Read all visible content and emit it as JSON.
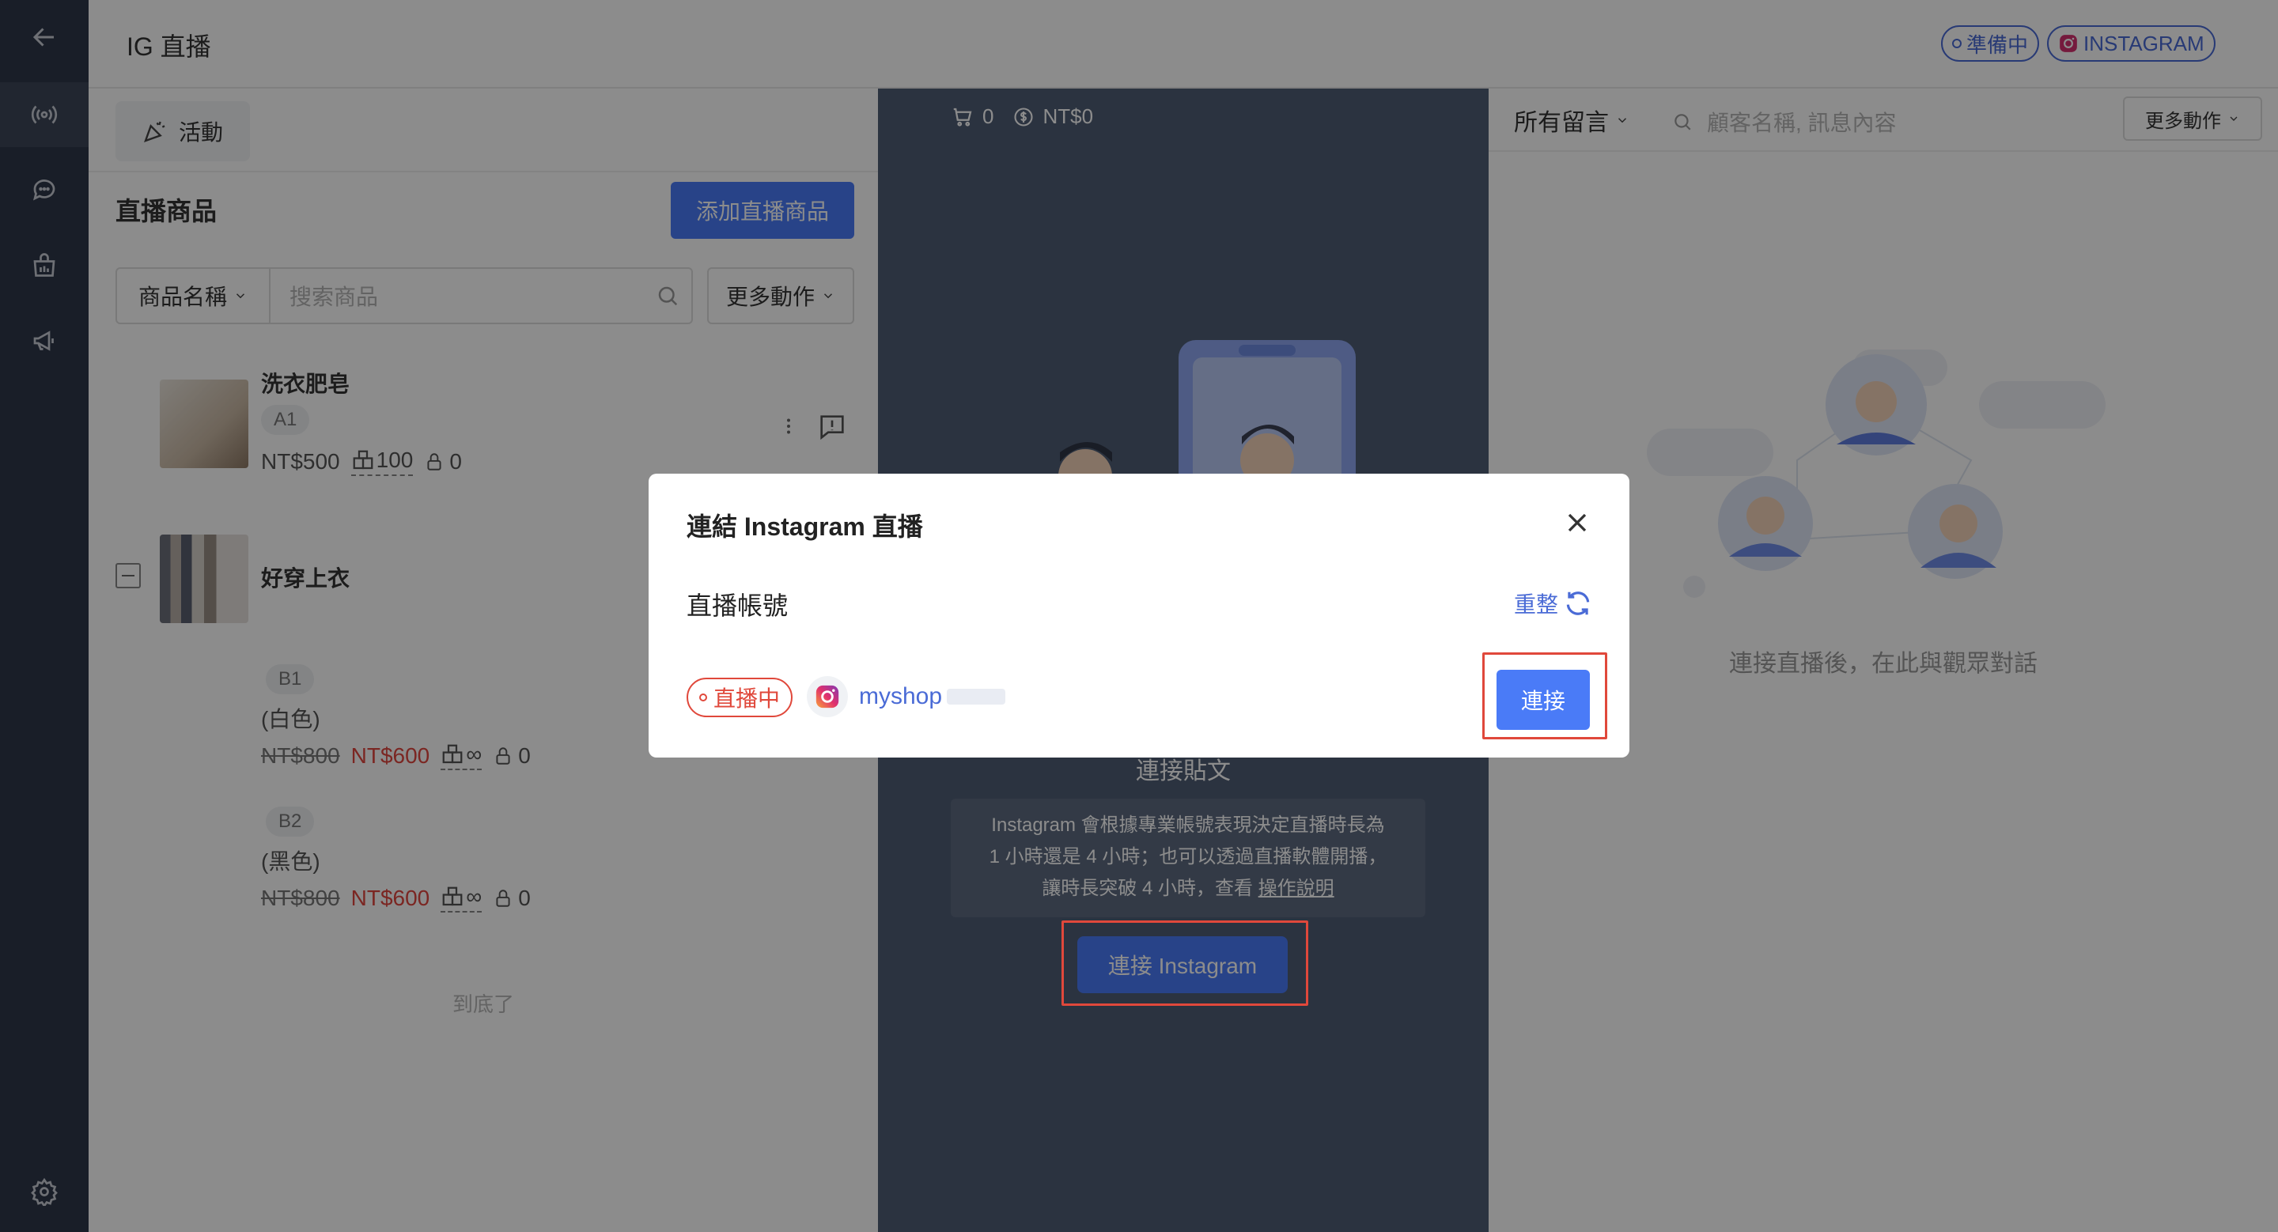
{
  "header": {
    "title": "IG 直播",
    "status_pill": "準備中",
    "platform_pill": "INSTAGRAM"
  },
  "sidebar": {
    "items": [
      "back-arrow-icon",
      "broadcast-icon",
      "chat-icon",
      "shop-icon",
      "megaphone-icon",
      "gear-icon"
    ]
  },
  "left": {
    "tab_label": "活動",
    "section_title": "直播商品",
    "add_button": "添加直播商品",
    "filter_select": "商品名稱",
    "search_placeholder": "搜索商品",
    "more_actions": "更多動作",
    "products": [
      {
        "name": "洗衣肥皂",
        "sku": "A1",
        "price": "NT$500",
        "stock": "100",
        "locked": "0"
      },
      {
        "name": "好穿上衣",
        "variants": [
          {
            "sku": "B1",
            "desc": "(白色)",
            "orig": "NT$800",
            "price": "NT$600",
            "stock": "∞",
            "locked": "0"
          },
          {
            "sku": "B2",
            "desc": "(黑色)",
            "orig": "NT$800",
            "price": "NT$600",
            "stock": "∞",
            "locked": "0"
          }
        ]
      }
    ],
    "bottom_note": "到底了"
  },
  "center": {
    "cart_count": "0",
    "cart_amount": "NT$0",
    "title": "連接貼文",
    "info_line1": "Instagram 會根據專業帳號表現決定直播時長為",
    "info_line2": "1 小時還是 4 小時；也可以透過直播軟體開播，",
    "info_line3": "讓時長突破 4 小時，查看",
    "info_link": "操作說明",
    "connect_button": "連接 Instagram"
  },
  "right": {
    "filter": "所有留言",
    "search_placeholder": "顧客名稱, 訊息內容",
    "more_actions": "更多動作",
    "empty_note": "連接直播後，在此與觀眾對話"
  },
  "modal": {
    "title": "連結 Instagram 直播",
    "account_label": "直播帳號",
    "refresh": "重整",
    "live_tag": "直播中",
    "account_name": "myshop",
    "connect": "連接"
  },
  "colors": {
    "sidebar": "#2f3849",
    "accent": "#4a7bf7",
    "alert": "#e0463e",
    "center_panel": "#4f5d75"
  }
}
